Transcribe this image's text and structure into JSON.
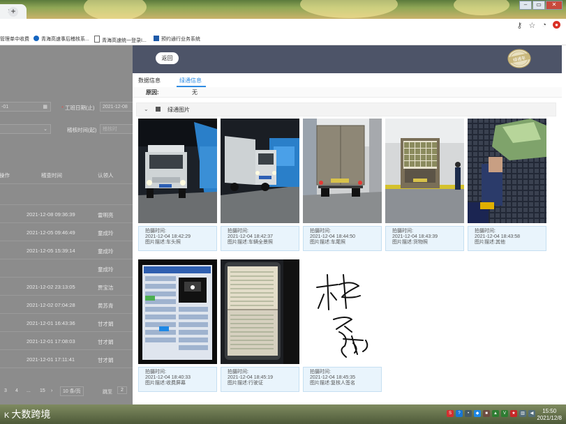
{
  "browser": {
    "tab_close": "×",
    "new_tab": "+",
    "window_buttons": [
      "–",
      "▭",
      "✕"
    ],
    "address_icons": [
      "key-icon",
      "star-icon",
      "profile-icon",
      "extension-icon"
    ]
  },
  "bookmarks": [
    {
      "label": "管理单中收费",
      "color": "#2e7d32"
    },
    {
      "label": "青海高速事后稽核系...",
      "color": "#1565c0"
    },
    {
      "label": "青海高速统一登录I...",
      "color": "#666666"
    },
    {
      "label": "预约通行业务系统",
      "color": "#1e5aa8"
    }
  ],
  "background_page": {
    "start_date_value": "-01",
    "end_date_label": "工班日期(止)",
    "end_date_value": "2021-12-08",
    "audit_time_label": "稽核时间(起)",
    "audit_time_placeholder": "稽核时",
    "column_headers": [
      "操作",
      "稽查时间",
      "认领人"
    ],
    "rows": [
      {
        "time": "",
        "person": ""
      },
      {
        "time": "2021-12-08 09:36:39",
        "person": "雷明亮"
      },
      {
        "time": "2021-12-05 09:46:49",
        "person": "童成玲"
      },
      {
        "time": "2021-12-05 15:39:14",
        "person": "童成玲"
      },
      {
        "time": "",
        "person": "童成玲"
      },
      {
        "time": "2021-12-02 23:13:05",
        "person": "贾宝洁"
      },
      {
        "time": "2021-12-02 07:04:28",
        "person": "黄苏青"
      },
      {
        "time": "2021-12-01 16:43:36",
        "person": "甘才娟"
      },
      {
        "time": "2021-12-01 17:08:03",
        "person": "甘才娟"
      },
      {
        "time": "2021-12-01 17:11:41",
        "person": "甘才娟"
      }
    ],
    "pagination": {
      "pages": [
        "3",
        "4",
        "...",
        "15"
      ],
      "page_size": "10 条/页",
      "jump": "跳至",
      "jump_value": "2"
    }
  },
  "modal": {
    "back_button": "返回",
    "stamp_text": "绿通车",
    "tabs": [
      "数据信息",
      "绿通信息"
    ],
    "active_tab": 1,
    "reason_label": "原因:",
    "reason_value": "无",
    "section_title": "绿通图片",
    "photos": [
      {
        "time_label": "拍摄时间:",
        "time": "2021-12-04 18:42:29",
        "desc": "图片描述:车头照",
        "kind": "truck-front"
      },
      {
        "time_label": "拍摄时间:",
        "time": "2021-12-04 18:42:37",
        "desc": "图片描述:车辆全景照",
        "kind": "truck-side"
      },
      {
        "time_label": "拍摄时间:",
        "time": "2021-12-04 18:44:50",
        "desc": "图片描述:车尾照",
        "kind": "truck-rear"
      },
      {
        "time_label": "拍摄时间:",
        "time": "2021-12-04 18:43:39",
        "desc": "图片描述:货物照",
        "kind": "cargo"
      },
      {
        "time_label": "拍摄时间:",
        "time": "2021-12-04 18:43:58",
        "desc": "图片描述:其他",
        "kind": "other"
      },
      {
        "time_label": "拍摄时间:",
        "time": "2021-12-04 18:40:33",
        "desc": "图片描述:收费屏幕",
        "kind": "screen"
      },
      {
        "time_label": "拍摄时间:",
        "time": "2021-12-04 18:45:19",
        "desc": "图片描述:行驶证",
        "kind": "license"
      },
      {
        "time_label": "拍摄时间:",
        "time": "2021-12-04 18:45:35",
        "desc": "图片描述:复核人签名",
        "kind": "signature"
      }
    ]
  },
  "taskbar": {
    "watermark_logo": "K",
    "watermark": "大数跨境",
    "time": "15:50",
    "date": "2021/12/8"
  }
}
